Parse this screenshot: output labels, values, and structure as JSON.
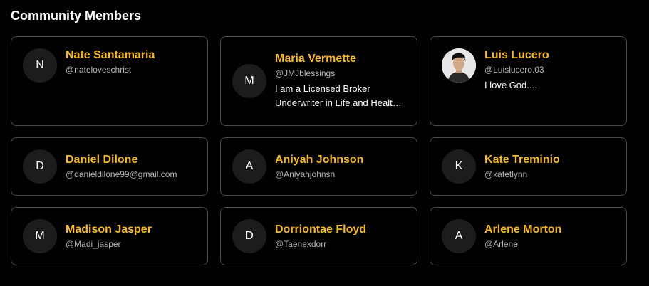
{
  "section": {
    "title": "Community Members"
  },
  "colors": {
    "accent": "#f5b82e",
    "card_border": "#4a4a4e",
    "avatar_bg": "#1c1c1c"
  },
  "members": [
    {
      "initial": "N",
      "name": "Nate Santamaria",
      "handle": "@nateloveschrist",
      "bio": ""
    },
    {
      "initial": "M",
      "name": "Maria Vermette",
      "handle": "@JMJblessings",
      "bio": "I am a Licensed Broker Underwriter in Life and Health Insurance"
    },
    {
      "initial": "",
      "name": "Luis Lucero",
      "handle": "@Luislucero.03",
      "bio": "I love God....",
      "avatar_icon": "user-photo"
    },
    {
      "initial": "D",
      "name": "Daniel Dilone",
      "handle": "@danieldilone99@gmail.com",
      "bio": ""
    },
    {
      "initial": "A",
      "name": "Aniyah Johnson",
      "handle": "@Aniyahjohnsn",
      "bio": ""
    },
    {
      "initial": "K",
      "name": "Kate Treminio",
      "handle": "@katetlynn",
      "bio": ""
    },
    {
      "initial": "M",
      "name": "Madison Jasper",
      "handle": "@Madi_jasper",
      "bio": ""
    },
    {
      "initial": "D",
      "name": "Dorriontae Floyd",
      "handle": "@Taenexdorr",
      "bio": ""
    },
    {
      "initial": "A",
      "name": "Arlene Morton",
      "handle": "@Arlene",
      "bio": ""
    }
  ]
}
